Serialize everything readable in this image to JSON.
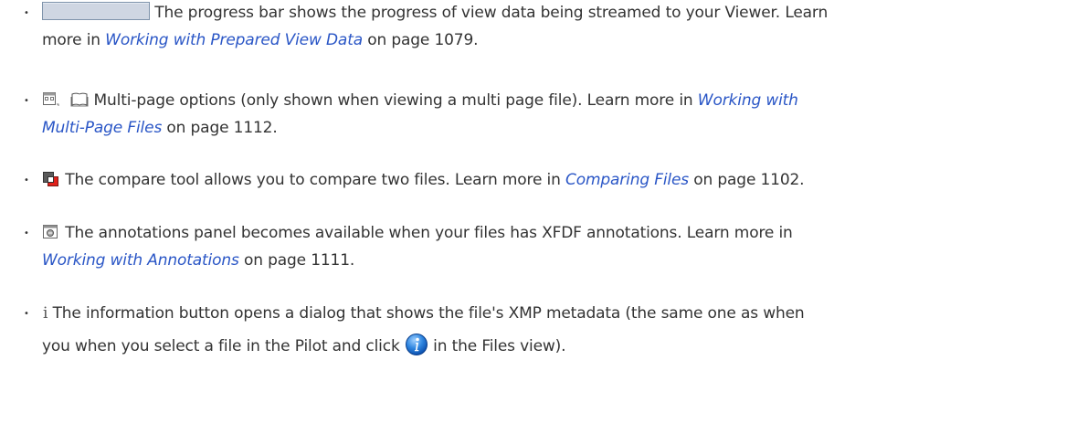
{
  "items": [
    {
      "icons": [
        "progress-bar-icon"
      ],
      "line1": {
        "text": "The progress bar shows the progress of view data being streamed to your Viewer. Learn"
      },
      "line2": {
        "prefix": "more in ",
        "link": "Working with Prepared View Data",
        "suffix": " on page 1079."
      }
    },
    {
      "icons": [
        "multi-page-thumbnails-icon",
        "open-book-icon"
      ],
      "line1": {
        "text": "Multi-page options (only shown when viewing a multi page file). Learn more in ",
        "link": "Working with"
      },
      "line2": {
        "link": "Multi-Page Files",
        "suffix": " on page 1112."
      }
    },
    {
      "icons": [
        "compare-icon"
      ],
      "line1": {
        "text": "The compare tool allows you to compare two files. Learn more in ",
        "link": "Comparing Files",
        "suffix": " on page 1102."
      }
    },
    {
      "icons": [
        "annotations-panel-icon"
      ],
      "line1": {
        "text": "The annotations panel becomes available when your files has XFDF annotations. Learn more in"
      },
      "line2": {
        "link": "Working with Annotations",
        "suffix": " on page 1111."
      }
    },
    {
      "icons": [
        "info-glyph-icon",
        "info-round-icon"
      ],
      "line1": {
        "glyph": "i",
        "text": "The information button opens a dialog that shows the file's XMP metadata (the same one as when"
      },
      "line2": {
        "prefix": "you when you select a file in the Pilot and click ",
        "suffix": " in the Files view)."
      }
    }
  ]
}
